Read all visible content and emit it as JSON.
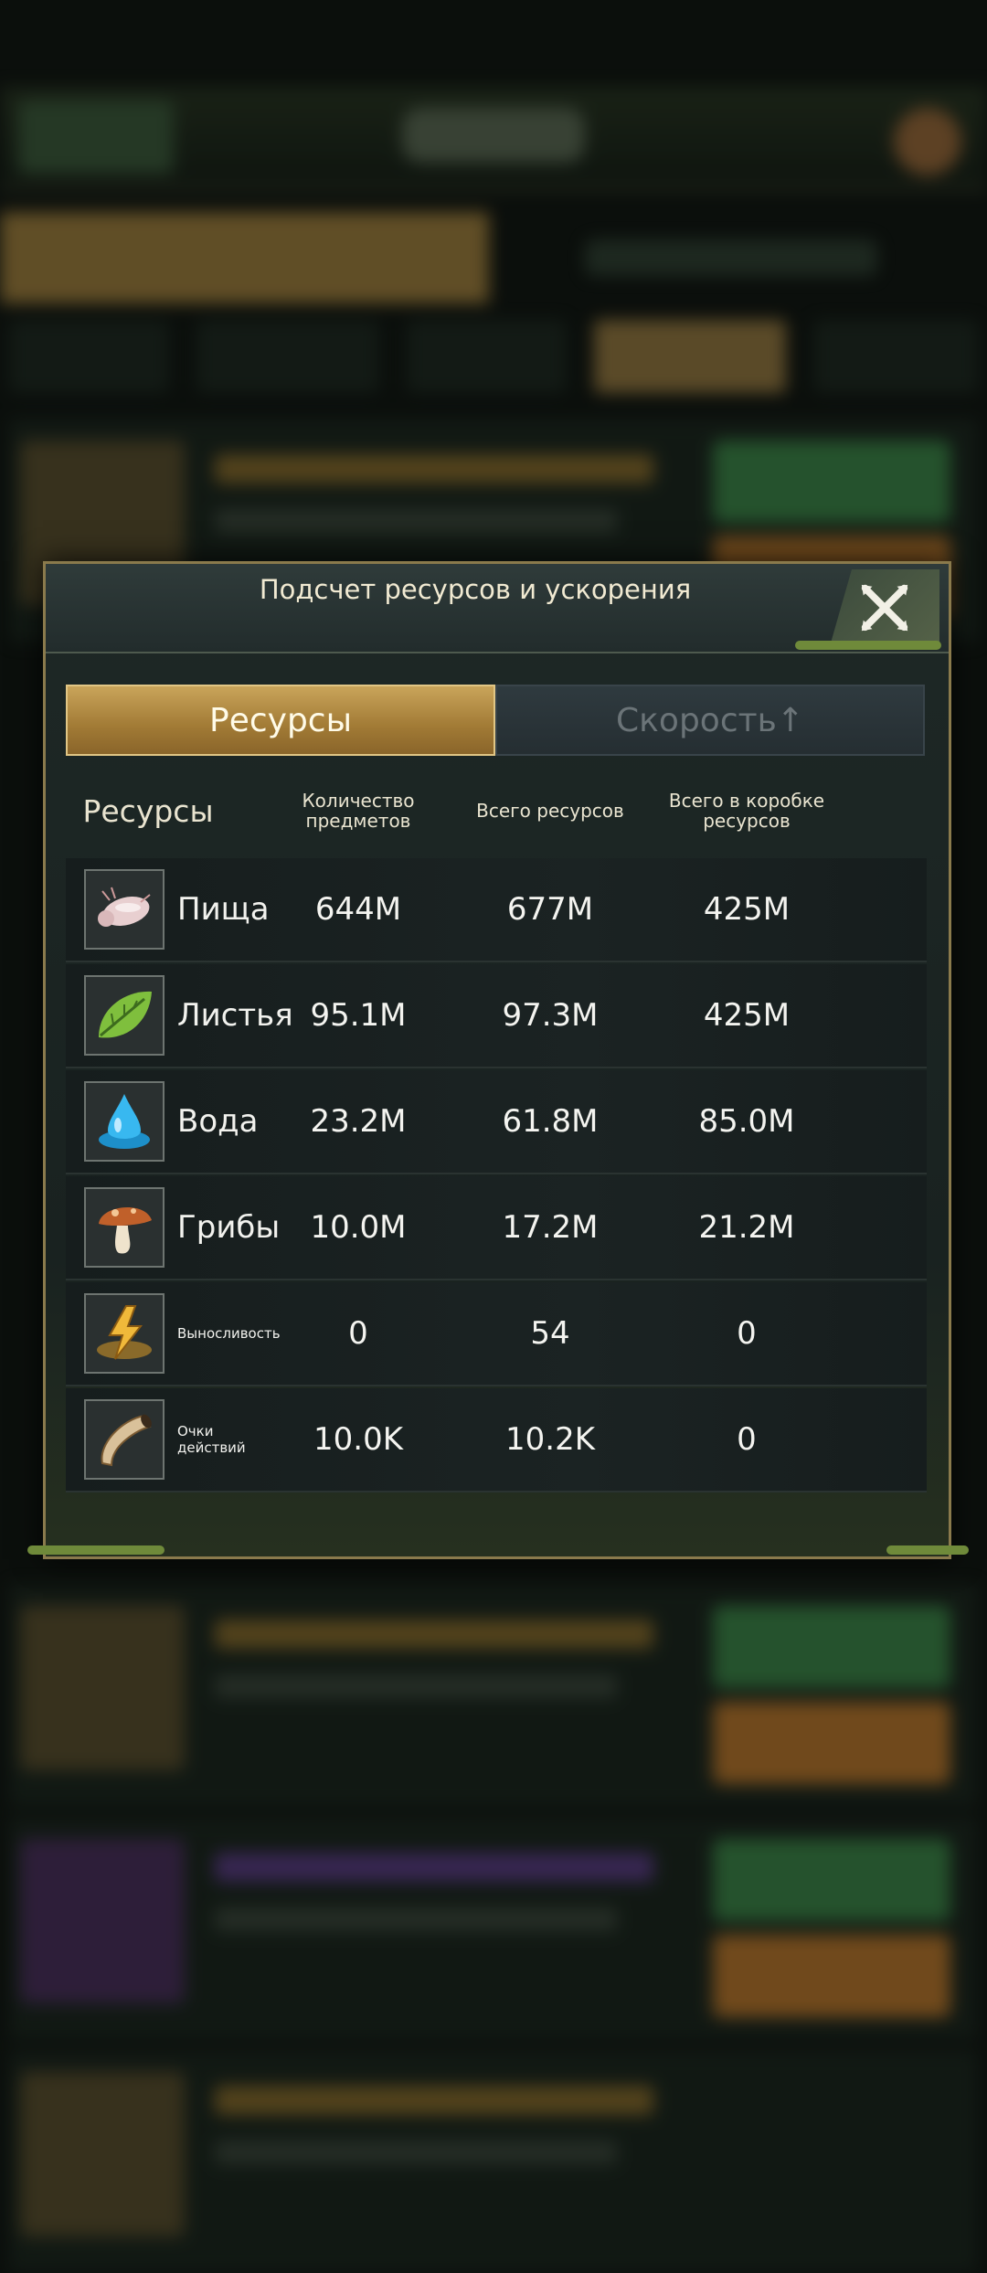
{
  "modal": {
    "title": "Подсчет ресурсов и ускорения",
    "tabs": [
      "Ресурсы",
      "Скорость↑"
    ],
    "active_tab": 0
  },
  "table": {
    "headers": [
      "Ресурсы",
      "Количество предметов",
      "Всего ресурсов",
      "Всего в коробке ресурсов"
    ],
    "rows": [
      {
        "name": "Пища",
        "icon": "food-icon",
        "items": "644M",
        "total": "677M",
        "box": "425M"
      },
      {
        "name": "Листья",
        "icon": "leaf-icon",
        "items": "95.1M",
        "total": "97.3M",
        "box": "425M"
      },
      {
        "name": "Вода",
        "icon": "water-drop-icon",
        "items": "23.2M",
        "total": "61.8M",
        "box": "85.0M"
      },
      {
        "name": "Грибы",
        "icon": "mushroom-icon",
        "items": "10.0M",
        "total": "17.2M",
        "box": "21.2M"
      },
      {
        "name": "Выносливость",
        "icon": "stamina-icon",
        "items": "0",
        "total": "54",
        "box": "0"
      },
      {
        "name": "Очки действий",
        "icon": "horn-icon",
        "items": "10.0K",
        "total": "10.2K",
        "box": "0"
      }
    ]
  },
  "colors": {
    "accent_gold": "#c9a45a",
    "panel_bg": "#1e2826",
    "text_light": "#f4f4f0",
    "tab_inactive_text": "#6b7478"
  }
}
